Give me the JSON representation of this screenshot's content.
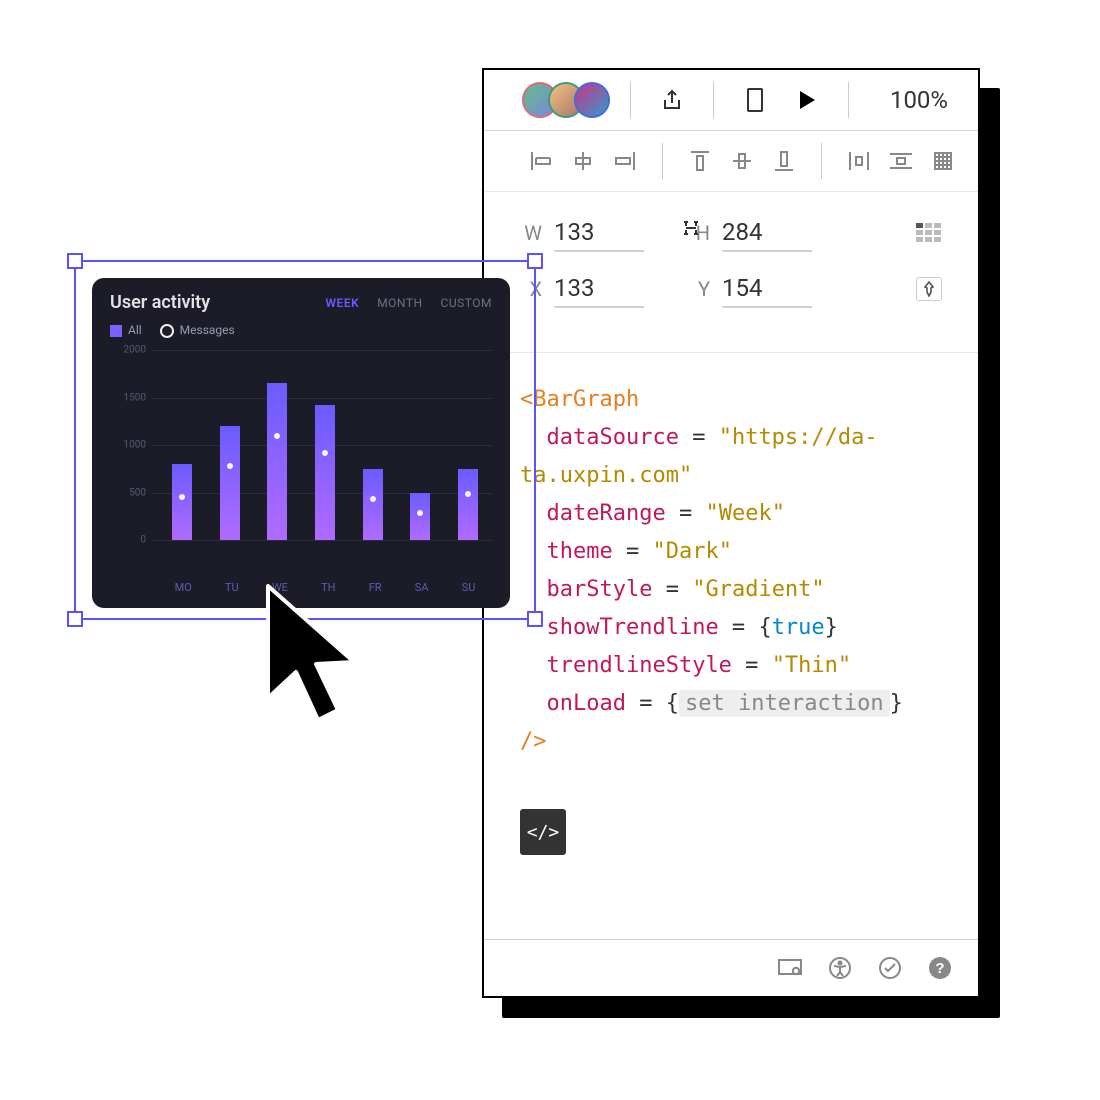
{
  "toolbar": {
    "zoom": "100%",
    "avatar_colors": [
      "#e0687a",
      "#3a9d7a",
      "#3f6dd8"
    ]
  },
  "geometry": {
    "w_label": "W",
    "w_value": "133",
    "h_label": "H",
    "h_value": "284",
    "x_label": "X",
    "x_value": "133",
    "y_label": "Y",
    "y_value": "154"
  },
  "code": {
    "tag_open": "<BarGraph",
    "tag_close": "/>",
    "attrs": [
      {
        "name": "dataSource",
        "str": "\"https://da-\nta.uxpin.com\""
      },
      {
        "name": "dateRange",
        "str": "\"Week\""
      },
      {
        "name": "theme",
        "str": "\"Dark\""
      },
      {
        "name": "barStyle",
        "str": "\"Gradient\""
      },
      {
        "name": "showTrendline",
        "bool": "true"
      },
      {
        "name": "trendlineStyle",
        "str": "\"Thin\""
      },
      {
        "name": "onLoad",
        "placeholder": "set interaction"
      }
    ]
  },
  "code_button_glyph": "</>",
  "widget": {
    "title": "User activity",
    "tabs": [
      "WEEK",
      "MONTH",
      "CUSTOM"
    ],
    "active_tab": "WEEK",
    "legend": {
      "all": "All",
      "messages": "Messages"
    }
  },
  "chart_data": {
    "type": "bar",
    "title": "User activity",
    "xlabel": "",
    "ylabel": "",
    "categories": [
      "MO",
      "TU",
      "WE",
      "TH",
      "FR",
      "SA",
      "SU"
    ],
    "series": [
      {
        "name": "All",
        "values": [
          800,
          1200,
          1650,
          1420,
          750,
          500,
          750
        ]
      },
      {
        "name": "Messages",
        "values": [
          450,
          780,
          1100,
          920,
          430,
          280,
          480
        ]
      }
    ],
    "yticks": [
      0,
      500,
      1000,
      1500,
      2000
    ],
    "ylim": [
      0,
      2000
    ]
  }
}
